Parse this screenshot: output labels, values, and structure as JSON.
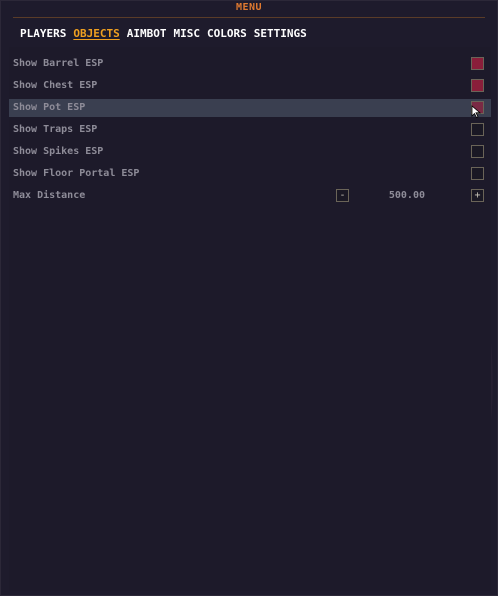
{
  "window": {
    "title": "MENU"
  },
  "tabs": [
    {
      "label": "PLAYERS",
      "active": false
    },
    {
      "label": "OBJECTS",
      "active": true
    },
    {
      "label": "AIMBOT",
      "active": false
    },
    {
      "label": "MISC",
      "active": false
    },
    {
      "label": "COLORS",
      "active": false
    },
    {
      "label": "SETTINGS",
      "active": false
    }
  ],
  "options": [
    {
      "label": "Show Barrel ESP",
      "checked": true
    },
    {
      "label": "Show Chest ESP",
      "checked": true
    },
    {
      "label": "Show Pot ESP",
      "checked": true,
      "hovered": true
    },
    {
      "label": "Show Traps ESP",
      "checked": false
    },
    {
      "label": "Show Spikes ESP",
      "checked": false
    },
    {
      "label": "Show Floor Portal ESP",
      "checked": false
    }
  ],
  "max_distance": {
    "label": "Max Distance",
    "value": "500.00",
    "decrement_label": "-",
    "increment_label": "+"
  },
  "colors": {
    "accent": "#f0a020",
    "title": "#e07a30",
    "checked": "#8a1e3a"
  }
}
